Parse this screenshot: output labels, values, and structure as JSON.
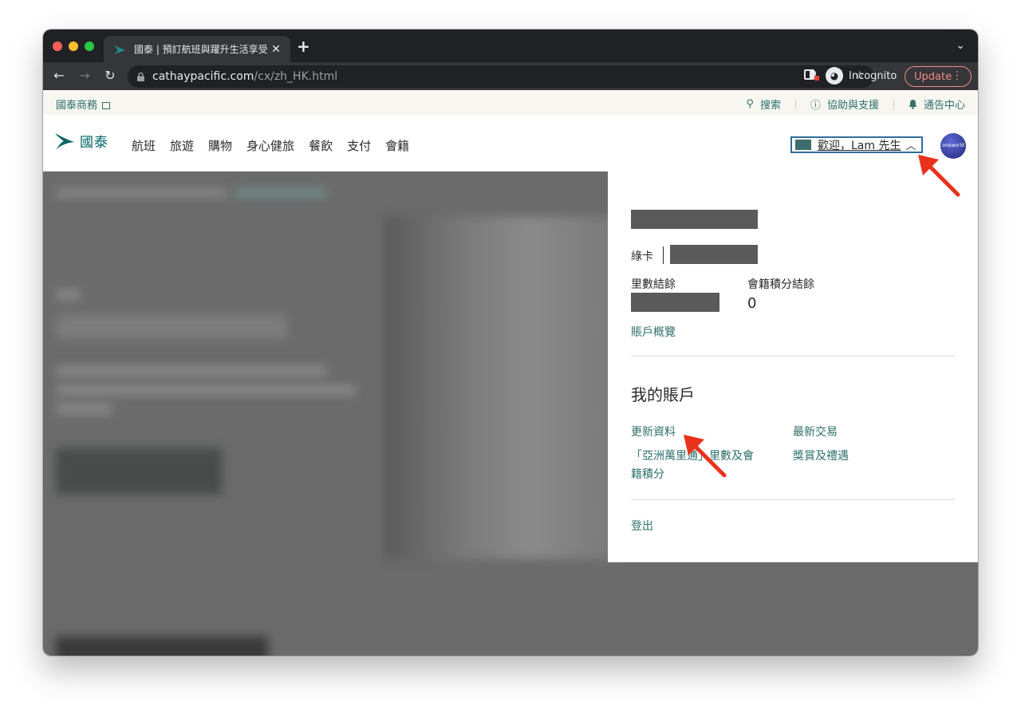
{
  "browser": {
    "tab_title": "國泰 | 預訂航班與躍升生活享受",
    "tab_close": "✕",
    "new_tab": "+",
    "tab_search": "⌄",
    "url_host": "cathaypacific.com",
    "url_path": "/cx/zh_HK.html",
    "back": "←",
    "forward": "→",
    "reload": "↻",
    "star": "☆",
    "incognito_label": "Incognito",
    "update_label": "Update",
    "update_menu": "⋮"
  },
  "utility": {
    "business": "國泰商務",
    "search": "搜索",
    "help": "協助與支援",
    "notifications": "通告中心"
  },
  "header": {
    "logo_text": "國泰",
    "nav": [
      "航班",
      "旅遊",
      "購物",
      "身心健旅",
      "餐飲",
      "支付",
      "會籍"
    ],
    "welcome": "歡迎，Lam 先生",
    "oneworld_label": "oneworld"
  },
  "account": {
    "tier": "綠卡",
    "miles_label": "里數結餘",
    "points_label": "會籍積分結餘",
    "points_value": "0",
    "overview_link": "賬戶概覽",
    "my_account_heading": "我的賬戶",
    "links": {
      "update_profile": "更新資料",
      "asia_miles_line1": "「亞洲萬里通」里數及會",
      "asia_miles_line2": "籍積分",
      "recent_transactions": "最新交易",
      "rewards": "獎賞及禮遇"
    },
    "logout": "登出"
  },
  "colors": {
    "brand": "#006564",
    "link": "#2d6f6a",
    "annotation_arrow": "#e8321c"
  }
}
